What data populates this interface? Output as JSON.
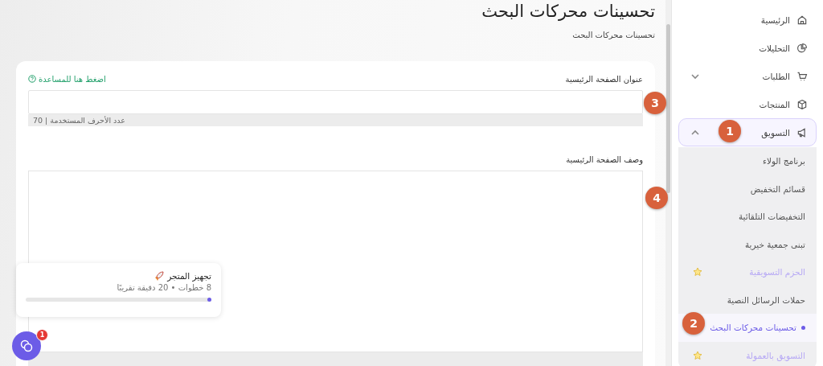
{
  "page": {
    "title": "تحسينات محركات البحث",
    "breadcrumb": "تحسينات محركات البحث"
  },
  "form": {
    "help_link": "اضغط هنا للمساعدة",
    "fields": [
      {
        "kind": "input",
        "label": "عنوان الصفحة الرئيسية",
        "counter": "عدد الأحرف المستخدمة | 70"
      },
      {
        "kind": "textarea",
        "label": "وصف الصفحة الرئيسية"
      }
    ]
  },
  "sidebar": {
    "items": [
      {
        "label": "الرئيسية"
      },
      {
        "label": "التحليلات"
      },
      {
        "label": "الطلبات",
        "expanded": false
      },
      {
        "label": "المنتجات"
      },
      {
        "label": "التسويق",
        "expanded": true,
        "children": [
          {
            "label": "برنامج الولاء",
            "selected": false,
            "premium": false
          },
          {
            "label": "قسائم التخفيض",
            "selected": false,
            "premium": false
          },
          {
            "label": "التخفيضات التلقائية",
            "selected": false,
            "premium": false
          },
          {
            "label": "تبنى جمعية خيرية",
            "selected": false,
            "premium": false
          },
          {
            "label": "الحزم التسويقية",
            "selected": false,
            "premium": true
          },
          {
            "label": "حملات الرسائل النصية",
            "selected": false,
            "premium": false
          },
          {
            "label": "تحسينات محركات البحث",
            "selected": true,
            "premium": false
          },
          {
            "label": "التسويق بالعمولة",
            "selected": false,
            "premium": true
          }
        ]
      }
    ]
  },
  "setup_card": {
    "title": "تجهيز المتجر",
    "subtitle": "8 خطوات • 20 دقيقة تقريبًا",
    "level": 0.02
  },
  "chat": {
    "badge": "1"
  },
  "markers": [
    {
      "label": "1"
    },
    {
      "label": "2"
    },
    {
      "label": "3"
    },
    {
      "label": "4"
    }
  ]
}
